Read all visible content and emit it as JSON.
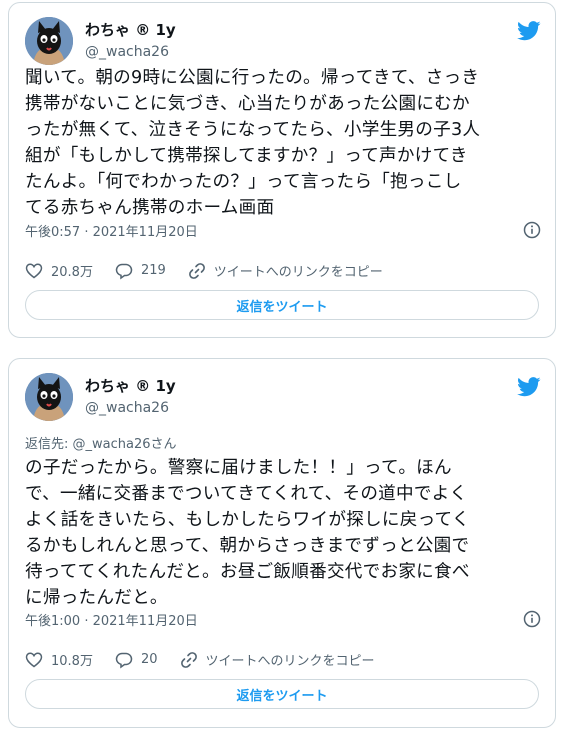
{
  "colors": {
    "accent": "#1d9bf0",
    "muted": "#536471",
    "border": "#cfd9de",
    "avatar_bg": "#5a7ea8"
  },
  "tweets": [
    {
      "display_name": "わちゃ ® 1y",
      "handle": "@_wacha26",
      "reply_to": "",
      "text": "聞いて。朝の9時に公園に行ったの。帰ってきて、さっき\n携帯がないことに気づき、心当たりがあった公園にむか\nったが無くて、泣きそうになってたら、小学生男の子3人\n組が「もしかして携帯探してますか？」って声かけてき\nたんよ。「何でわかったの？」って言ったら「抱っこし\nてる赤ちゃん携帯のホーム画面",
      "timestamp": "午後0:57 · 2021年11月20日",
      "likes": "20.8万",
      "replies": "219",
      "share_label": "ツイートへのリンクをコピー",
      "reply_button": "返信をツイート"
    },
    {
      "display_name": "わちゃ ® 1y",
      "handle": "@_wacha26",
      "reply_to": "返信先: @_wacha26さん",
      "text": "の子だったから。警察に届けました！！」って。ほん\nで、一緒に交番までついてきてくれて、その道中でよく\nよく話をきいたら、もしかしたらワイが探しに戻ってく\nるかもしれんと思って、朝からさっきまでずっと公園で\n待っててくれたんだと。お昼ご飯順番交代でお家に食べ\nに帰ったんだと。",
      "timestamp": "午後1:00 · 2021年11月20日",
      "likes": "10.8万",
      "replies": "20",
      "share_label": "ツイートへのリンクをコピー",
      "reply_button": "返信をツイート"
    }
  ]
}
